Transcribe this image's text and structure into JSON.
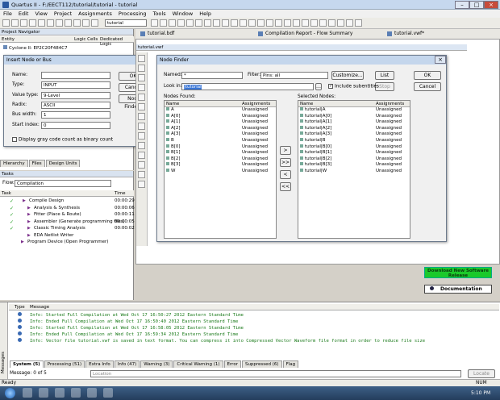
{
  "window": {
    "title": "Quartus II - F:/EECT112/tutorial/tutorial - tutorial"
  },
  "menu": [
    "File",
    "Edit",
    "View",
    "Project",
    "Assignments",
    "Processing",
    "Tools",
    "Window",
    "Help"
  ],
  "toolbar": {
    "project_combo": "tutorial"
  },
  "doc_tabs": [
    "tutorial.bdf",
    "Compilation Report - Flow Summary",
    "tutorial.vwf*"
  ],
  "project_nav": {
    "title": "Project Navigator",
    "col_entity": "Entity",
    "col_cells": "Logic Cells",
    "col_dedicated": "Dedicated Logic",
    "device": "Cyclone II: EP2C20F484C7",
    "tabs": [
      "Hierarchy",
      "Files",
      "Design Units"
    ]
  },
  "insert_node": {
    "title": "Insert Node or Bus",
    "fields": [
      {
        "label": "Name:",
        "value": ""
      },
      {
        "label": "Type:",
        "value": "INPUT"
      },
      {
        "label": "Value type:",
        "value": "9-Level"
      },
      {
        "label": "Radix:",
        "value": "ASCII"
      },
      {
        "label": "Bus width:",
        "value": "1"
      },
      {
        "label": "Start index:",
        "value": "0"
      }
    ],
    "checkbox": "Display gray code count as binary count",
    "ok": "OK",
    "cancel": "Cancel",
    "node_finder": "Node Finder..."
  },
  "vwf_title": "tutorial.vwf",
  "node_finder": {
    "title": "Node Finder",
    "named_label": "Named:",
    "named_value": "*",
    "filter_label": "Filter:",
    "filter_value": "Pins: all",
    "customize": "Customize...",
    "list": "List",
    "stop": "Stop",
    "ok": "OK",
    "cancel": "Cancel",
    "lookin_label": "Look in:",
    "lookin_value": "|tutorial",
    "include_sub": "Include subentities",
    "found_label": "Nodes Found:",
    "selected_label": "Selected Nodes:",
    "col_name": "Name",
    "col_assign": "Assignments",
    "found": [
      [
        "A",
        "Unassigned"
      ],
      [
        "A[0]",
        "Unassigned"
      ],
      [
        "A[1]",
        "Unassigned"
      ],
      [
        "A[2]",
        "Unassigned"
      ],
      [
        "A[3]",
        "Unassigned"
      ],
      [
        "B",
        "Unassigned"
      ],
      [
        "B[0]",
        "Unassigned"
      ],
      [
        "B[1]",
        "Unassigned"
      ],
      [
        "B[2]",
        "Unassigned"
      ],
      [
        "B[3]",
        "Unassigned"
      ],
      [
        "W",
        "Unassigned"
      ]
    ],
    "selected": [
      [
        "tutorial|A",
        "Unassigned"
      ],
      [
        "tutorial|A[0]",
        "Unassigned"
      ],
      [
        "tutorial|A[1]",
        "Unassigned"
      ],
      [
        "tutorial|A[2]",
        "Unassigned"
      ],
      [
        "tutorial|A[3]",
        "Unassigned"
      ],
      [
        "tutorial|B",
        "Unassigned"
      ],
      [
        "tutorial|B[0]",
        "Unassigned"
      ],
      [
        "tutorial|B[1]",
        "Unassigned"
      ],
      [
        "tutorial|B[2]",
        "Unassigned"
      ],
      [
        "tutorial|B[3]",
        "Unassigned"
      ],
      [
        "tutorial|W",
        "Unassigned"
      ]
    ],
    "move_buttons": [
      ">",
      ">>",
      "<",
      "<<"
    ]
  },
  "tasks": {
    "title": "Tasks",
    "flow_label": "Flow:",
    "flow_value": "Compilation",
    "col_task": "Task",
    "col_time": "Time",
    "items": [
      [
        "Compile Design",
        "00:00:29"
      ],
      [
        "Analysis & Synthesis",
        "00:00:06"
      ],
      [
        "Fitter (Place & Route)",
        "00:00:11"
      ],
      [
        "Assembler (Generate programming files)",
        "00:00:05"
      ],
      [
        "Classic Timing Analysis",
        "00:00:02"
      ],
      [
        "EDA Netlist Writer",
        ""
      ],
      [
        "Program Device (Open Programmer)",
        ""
      ]
    ]
  },
  "promo": {
    "download": "Download New Software Release",
    "docs": "Documentation"
  },
  "messages": {
    "col_type": "Type",
    "col_message": "Message",
    "lines": [
      "Info: Started Full Compilation at Wed Oct 17 16:50:27 2012 Eastern Standard Time",
      "Info: Ended Full Compilation at Wed Oct 17 16:50:40 2012 Eastern Standard Time",
      "Info: Started Full Compilation at Wed Oct 17 16:58:05 2012 Eastern Standard Time",
      "Info: Ended Full Compilation at Wed Oct 17 16:59:34 2012 Eastern Standard Time",
      "Info: Vector file tutorial.vwf is saved in text format. You can compress it into Compressed Vector Waveform file format in order to reduce file size"
    ],
    "tabs": [
      "System (5)",
      "Processing (51)",
      "Extra Info",
      "Info (47)",
      "Warning (3)",
      "Critical Warning (1)",
      "Error",
      "Suppressed (6)",
      "Flag"
    ],
    "count": "Message: 0 of 5",
    "location": "Location",
    "locate": "Locate"
  },
  "status": {
    "text": "Ready",
    "clock": "5:10 PM",
    "num": "NUM"
  },
  "side_label": "Messages"
}
